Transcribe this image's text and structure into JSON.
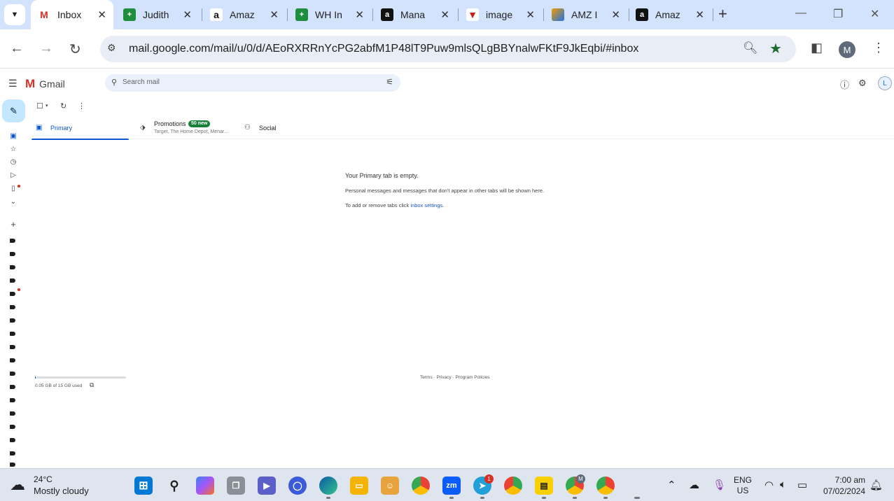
{
  "browser": {
    "tabs": [
      {
        "title": "Inbox",
        "icon": "gmail-icon",
        "color": "#d93025",
        "active": true
      },
      {
        "title": "Judith",
        "icon": "sheets-icon",
        "color": "#1e8e3e"
      },
      {
        "title": "Amaz",
        "icon": "amazon-icon",
        "color": "#232f3e"
      },
      {
        "title": "WH In",
        "icon": "sheets-icon",
        "color": "#1e8e3e"
      },
      {
        "title": "Mana",
        "icon": "amazon-icon",
        "color": "#111111"
      },
      {
        "title": "image",
        "icon": "image-site-icon",
        "color": "#c5221f"
      },
      {
        "title": "AMZ I",
        "icon": "amz-tool-icon",
        "color": "#f29900"
      },
      {
        "title": "Amaz",
        "icon": "amazon-icon",
        "color": "#111111"
      }
    ],
    "url": "mail.google.com/mail/u/0/d/AEoRXRRnYcPG2abfM1P48lT9Puw9mlsQLgBBYnalwFKtF9JkEqbi/#inbox",
    "profile_initial": "M"
  },
  "gmail": {
    "brand": "Gmail",
    "search_placeholder": "Search mail",
    "account_initial": "L",
    "tabs": {
      "primary": "Primary",
      "promotions": "Promotions",
      "promotions_badge": "50 new",
      "promotions_sub": "Target, The Home Depot, Menar...",
      "social": "Social"
    },
    "empty": {
      "title": "Your Primary tab is empty.",
      "line1": "Personal messages and messages that don't appear in other tabs will be shown here.",
      "line2_prefix": "To add or remove tabs click ",
      "line2_link": "inbox settings",
      "line2_suffix": "."
    },
    "storage": {
      "text": "0.05 GB of 15 GB used",
      "fraction": 0.0033
    },
    "footer": "Terms · Privacy · Program Policies"
  },
  "taskbar": {
    "weather_temp": "24°C",
    "weather_desc": "Mostly cloudy",
    "telegram_badge": "1",
    "chrome_profile_badge": "M",
    "lang_top": "ENG",
    "lang_bottom": "US",
    "time": "7:00 am",
    "date": "07/02/2024"
  },
  "colors": {
    "accent": "#0b57d0",
    "gmail_red": "#d93025",
    "tabstrip": "#d3e3fd",
    "badge_green": "#188038"
  }
}
